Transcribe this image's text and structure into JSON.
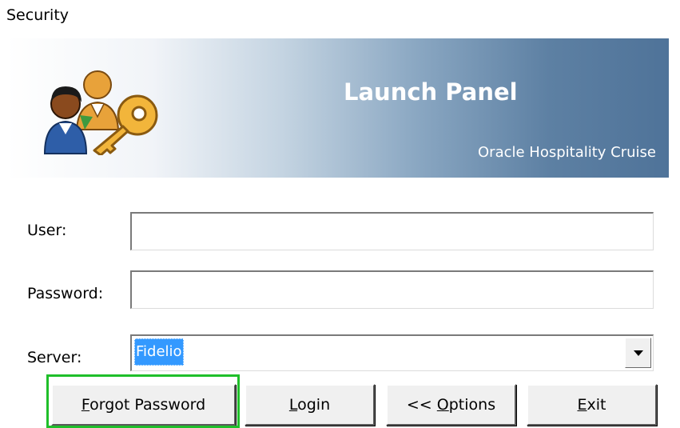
{
  "window": {
    "title": "Security"
  },
  "banner": {
    "title": "Launch Panel",
    "subtitle": "Oracle Hospitality Cruise",
    "icon": "users-key-icon"
  },
  "form": {
    "user": {
      "label": "User:",
      "value": ""
    },
    "password": {
      "label": "Password:",
      "value": ""
    },
    "server": {
      "label": "Server:",
      "value": "Fidelio",
      "selected_highlight_color": "#3399ff"
    }
  },
  "buttons": {
    "forgot": {
      "pre": "",
      "mnemonic": "F",
      "post": "orgot Password"
    },
    "login": {
      "pre": "",
      "mnemonic": "L",
      "post": "ogin"
    },
    "options": {
      "pre": "<< ",
      "mnemonic": "O",
      "post": "ptions"
    },
    "exit": {
      "pre": "",
      "mnemonic": "E",
      "post": "xit"
    }
  },
  "colors": {
    "focus_highlight": "#1fbf2a",
    "banner_dark": "#4f7399"
  }
}
